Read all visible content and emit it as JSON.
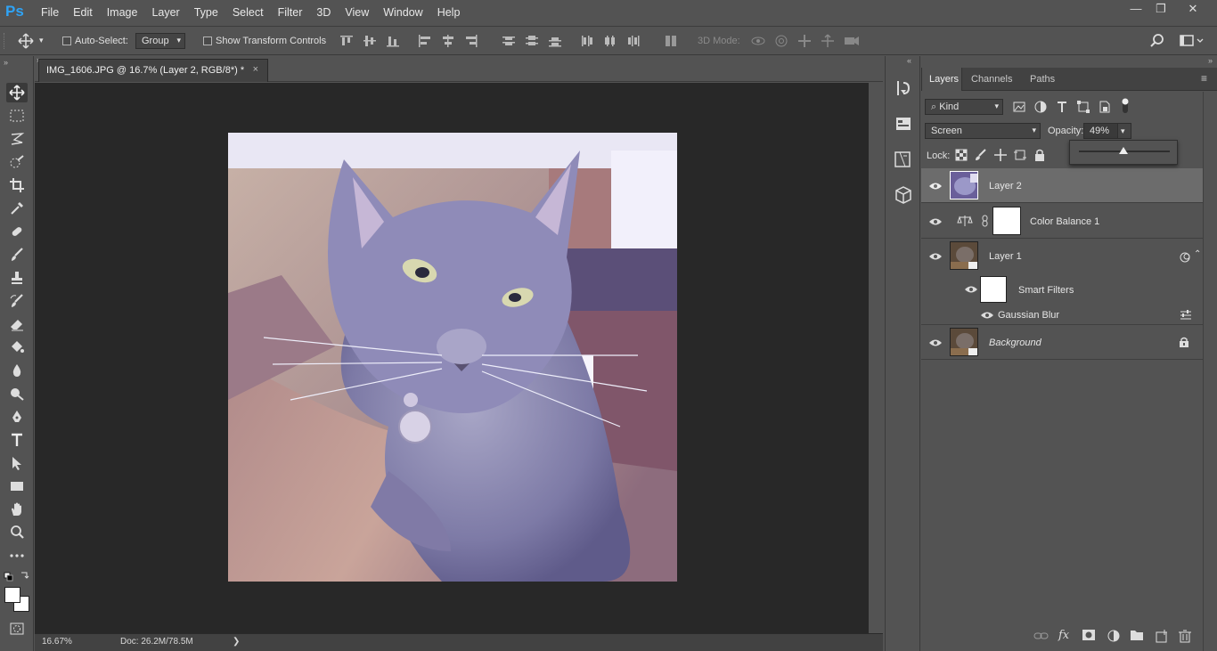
{
  "app": {
    "logo": "Ps",
    "menu": [
      "File",
      "Edit",
      "Image",
      "Layer",
      "Type",
      "Select",
      "Filter",
      "3D",
      "View",
      "Window",
      "Help"
    ]
  },
  "window_controls": {
    "minimize": "—",
    "restore": "❐",
    "close": "✕"
  },
  "options_bar": {
    "auto_select_label": "Auto-Select:",
    "auto_select_checked": false,
    "group_value": "Group",
    "show_transform_label": "Show Transform Controls",
    "show_transform_checked": false,
    "mode_3d_label": "3D Mode:"
  },
  "document": {
    "tab_title": "IMG_1606.JPG @ 16.7% (Layer 2, RGB/8*) *",
    "tab_close": "×",
    "zoom": "16.67%",
    "doc_info": "Doc: 26.2M/78.5M",
    "status_arrow": "❯"
  },
  "layers_panel": {
    "tabs": [
      "Layers",
      "Channels",
      "Paths"
    ],
    "active_tab": "Layers",
    "filter_kind": "Kind",
    "blend_mode": "Screen",
    "opacity_label": "Opacity:",
    "opacity_value": "49%",
    "opacity_slider_fraction": 0.49,
    "lock_label": "Lock:",
    "layers": [
      {
        "name": "Layer 2",
        "selected": true,
        "visible": true
      },
      {
        "name": "Color Balance 1",
        "selected": false,
        "visible": true
      },
      {
        "name": "Layer 1",
        "selected": false,
        "visible": true
      },
      {
        "name": "Smart Filters",
        "selected": false,
        "visible": true
      },
      {
        "name": "Gaussian Blur",
        "selected": false,
        "visible": true
      },
      {
        "name": "Background",
        "selected": false,
        "visible": true
      }
    ]
  },
  "colors": {
    "ui_bg": "#535353",
    "canvas_bg": "#282828",
    "selected_row": "#6c6c6c",
    "ps_blue": "#2fa3f5"
  }
}
